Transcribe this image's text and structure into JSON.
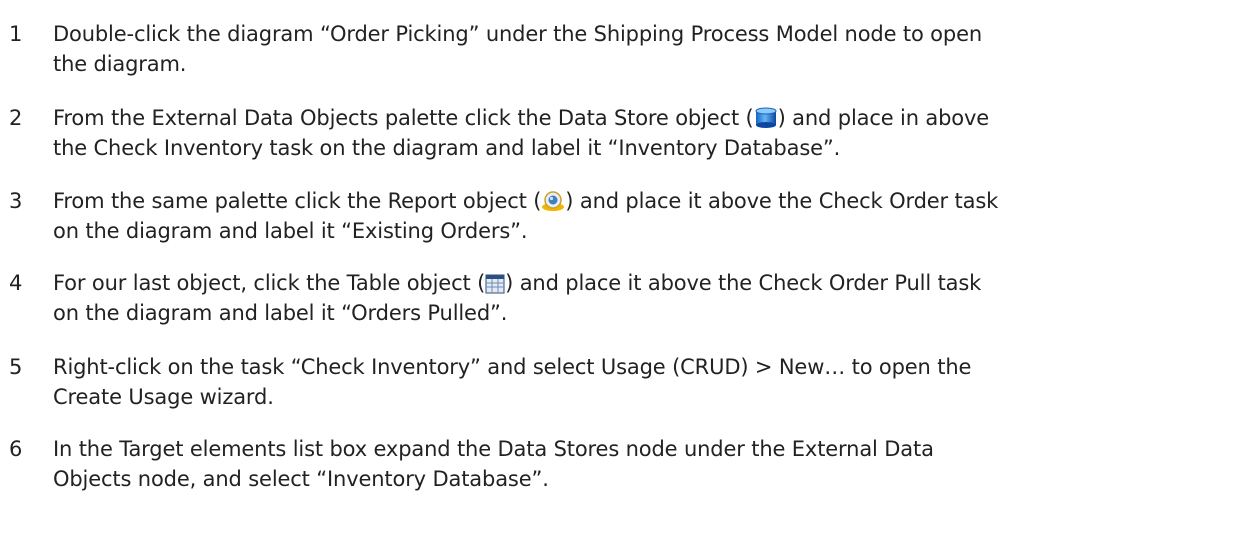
{
  "steps": [
    {
      "num": "1",
      "line1": "Double-click the diagram “Order Picking” under the Shipping Process Model node to open",
      "line2": "the diagram."
    },
    {
      "num": "2",
      "line1_before": "From the External Data Objects palette click the Data Store object (",
      "icon": "data-store-icon",
      "line1_after": ") and place in above",
      "line2": "the Check Inventory task on the diagram and label it “Inventory Database”."
    },
    {
      "num": "3",
      "line1_before": "From the same palette click the Report object (",
      "icon": "report-icon",
      "line1_after": ") and place it above the Check Order task",
      "line2": "on the diagram and label it “Existing Orders”."
    },
    {
      "num": "4",
      "line1_before": "For our last object, click the Table object (",
      "icon": "table-icon",
      "line1_after": ") and place it above the Check Order Pull task",
      "line2": "on the diagram and label it “Orders Pulled”."
    },
    {
      "num": "5",
      "line1": "Right-click on the task “Check Inventory” and select Usage (CRUD) > New… to open the",
      "line2": "Create Usage wizard."
    },
    {
      "num": "6",
      "line1": "In the Target elements list box expand the Data Stores node under the External Data",
      "line2": "Objects node, and select “Inventory Database”."
    }
  ]
}
